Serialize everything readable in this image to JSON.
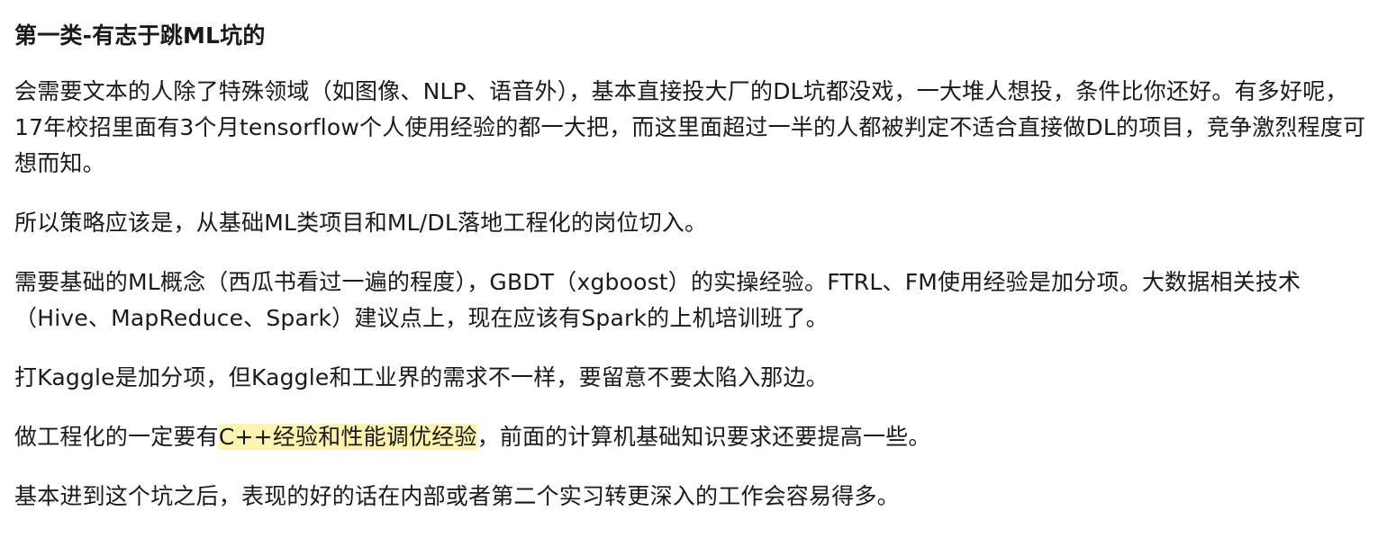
{
  "heading": "第一类-有志于跳ML坑的",
  "paragraphs": [
    "会需要文本的人除了特殊领域（如图像、NLP、语音外），基本直接投大厂的DL坑都没戏，一大堆人想投，条件比你还好。有多好呢，17年校招里面有3个月tensorflow个人使用经验的都一大把，而这里面超过一半的人都被判定不适合直接做DL的项目，竞争激烈程度可想而知。",
    "所以策略应该是，从基础ML类项目和ML/DL落地工程化的岗位切入。",
    "需要基础的ML概念（西瓜书看过一遍的程度），GBDT（xgboost）的实操经验。FTRL、FM使用经验是加分项。大数据相关技术（Hive、MapReduce、Spark）建议点上，现在应该有Spark的上机培训班了。",
    "打Kaggle是加分项，但Kaggle和工业界的需求不一样，要留意不要太陷入那边。"
  ],
  "engineering_paragraph": {
    "before": "做工程化的一定要有",
    "highlight": "C++经验和性能调优经验",
    "after": "，前面的计算机基础知识要求还要提高一些。"
  },
  "closing_paragraph": "基本进到这个坑之后，表现的好的话在内部或者第二个实习转更深入的工作会容易得多。",
  "colors": {
    "text": "#1a1a1a",
    "highlight": "#fff3b0",
    "background": "#ffffff"
  }
}
